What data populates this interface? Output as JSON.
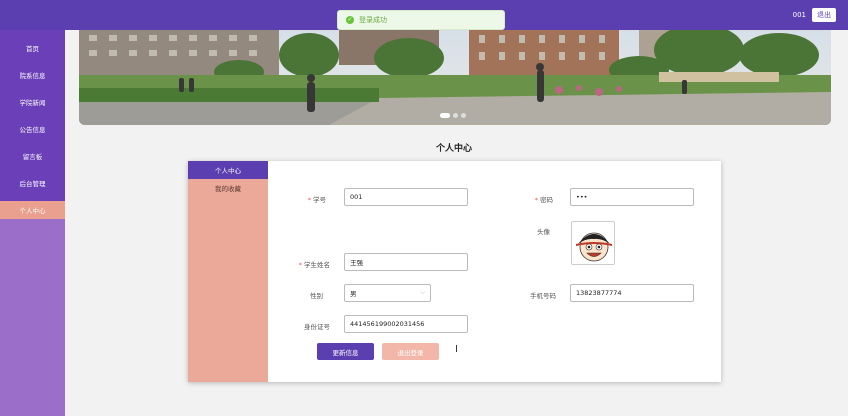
{
  "header": {
    "user_id": "001",
    "logout_label": "退出"
  },
  "toast": {
    "message": "登录成功"
  },
  "sidebar": {
    "items": [
      {
        "label": "首页"
      },
      {
        "label": "院系信息"
      },
      {
        "label": "学院新闻"
      },
      {
        "label": "公告信息"
      },
      {
        "label": "留言板"
      },
      {
        "label": "后台管理"
      },
      {
        "label": "个人中心"
      }
    ],
    "active_index": 6
  },
  "banner": {
    "slide_count": 3,
    "active_slide": 0
  },
  "page": {
    "title": "个人中心"
  },
  "profile_menu": {
    "items": [
      {
        "label": "个人中心"
      },
      {
        "label": "我的收藏"
      }
    ]
  },
  "form": {
    "student_no": {
      "label": "学号",
      "value": "001"
    },
    "password": {
      "label": "密码",
      "value": "•••"
    },
    "avatar": {
      "label": "头像"
    },
    "student_name": {
      "label": "学生姓名",
      "value": "王强"
    },
    "gender": {
      "label": "性别",
      "value": "男"
    },
    "phone": {
      "label": "手机号码",
      "value": "13823877774"
    },
    "id_card": {
      "label": "身份证号",
      "value": "441456199002031456"
    },
    "update_label": "更新信息",
    "logout_label": "退出登录"
  },
  "colors": {
    "primary": "#5b3fb0",
    "accent": "#e9a08f",
    "sidebar": "#9b6fc9"
  }
}
